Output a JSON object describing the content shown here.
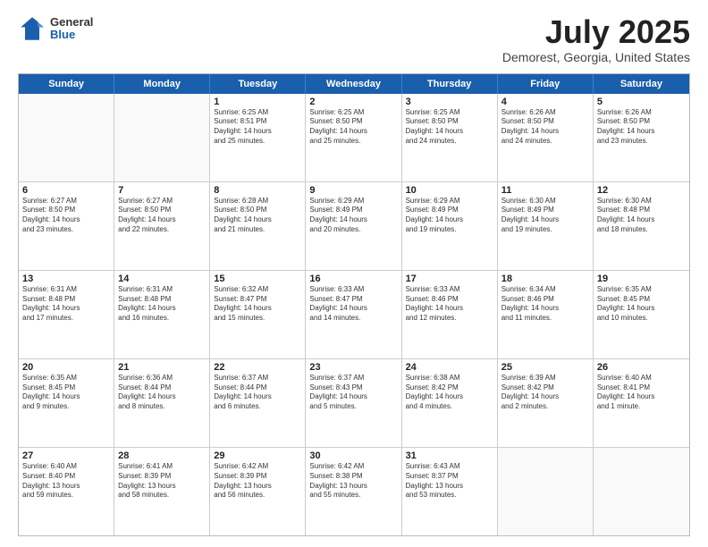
{
  "header": {
    "logo": {
      "general": "General",
      "blue": "Blue"
    },
    "title": "July 2025",
    "location": "Demorest, Georgia, United States"
  },
  "weekdays": [
    "Sunday",
    "Monday",
    "Tuesday",
    "Wednesday",
    "Thursday",
    "Friday",
    "Saturday"
  ],
  "weeks": [
    [
      {
        "day": "",
        "empty": true,
        "lines": []
      },
      {
        "day": "",
        "empty": true,
        "lines": []
      },
      {
        "day": "1",
        "empty": false,
        "lines": [
          "Sunrise: 6:25 AM",
          "Sunset: 8:51 PM",
          "Daylight: 14 hours",
          "and 25 minutes."
        ]
      },
      {
        "day": "2",
        "empty": false,
        "lines": [
          "Sunrise: 6:25 AM",
          "Sunset: 8:50 PM",
          "Daylight: 14 hours",
          "and 25 minutes."
        ]
      },
      {
        "day": "3",
        "empty": false,
        "lines": [
          "Sunrise: 6:25 AM",
          "Sunset: 8:50 PM",
          "Daylight: 14 hours",
          "and 24 minutes."
        ]
      },
      {
        "day": "4",
        "empty": false,
        "lines": [
          "Sunrise: 6:26 AM",
          "Sunset: 8:50 PM",
          "Daylight: 14 hours",
          "and 24 minutes."
        ]
      },
      {
        "day": "5",
        "empty": false,
        "lines": [
          "Sunrise: 6:26 AM",
          "Sunset: 8:50 PM",
          "Daylight: 14 hours",
          "and 23 minutes."
        ]
      }
    ],
    [
      {
        "day": "6",
        "empty": false,
        "lines": [
          "Sunrise: 6:27 AM",
          "Sunset: 8:50 PM",
          "Daylight: 14 hours",
          "and 23 minutes."
        ]
      },
      {
        "day": "7",
        "empty": false,
        "lines": [
          "Sunrise: 6:27 AM",
          "Sunset: 8:50 PM",
          "Daylight: 14 hours",
          "and 22 minutes."
        ]
      },
      {
        "day": "8",
        "empty": false,
        "lines": [
          "Sunrise: 6:28 AM",
          "Sunset: 8:50 PM",
          "Daylight: 14 hours",
          "and 21 minutes."
        ]
      },
      {
        "day": "9",
        "empty": false,
        "lines": [
          "Sunrise: 6:29 AM",
          "Sunset: 8:49 PM",
          "Daylight: 14 hours",
          "and 20 minutes."
        ]
      },
      {
        "day": "10",
        "empty": false,
        "lines": [
          "Sunrise: 6:29 AM",
          "Sunset: 8:49 PM",
          "Daylight: 14 hours",
          "and 19 minutes."
        ]
      },
      {
        "day": "11",
        "empty": false,
        "lines": [
          "Sunrise: 6:30 AM",
          "Sunset: 8:49 PM",
          "Daylight: 14 hours",
          "and 19 minutes."
        ]
      },
      {
        "day": "12",
        "empty": false,
        "lines": [
          "Sunrise: 6:30 AM",
          "Sunset: 8:48 PM",
          "Daylight: 14 hours",
          "and 18 minutes."
        ]
      }
    ],
    [
      {
        "day": "13",
        "empty": false,
        "lines": [
          "Sunrise: 6:31 AM",
          "Sunset: 8:48 PM",
          "Daylight: 14 hours",
          "and 17 minutes."
        ]
      },
      {
        "day": "14",
        "empty": false,
        "lines": [
          "Sunrise: 6:31 AM",
          "Sunset: 8:48 PM",
          "Daylight: 14 hours",
          "and 16 minutes."
        ]
      },
      {
        "day": "15",
        "empty": false,
        "lines": [
          "Sunrise: 6:32 AM",
          "Sunset: 8:47 PM",
          "Daylight: 14 hours",
          "and 15 minutes."
        ]
      },
      {
        "day": "16",
        "empty": false,
        "lines": [
          "Sunrise: 6:33 AM",
          "Sunset: 8:47 PM",
          "Daylight: 14 hours",
          "and 14 minutes."
        ]
      },
      {
        "day": "17",
        "empty": false,
        "lines": [
          "Sunrise: 6:33 AM",
          "Sunset: 8:46 PM",
          "Daylight: 14 hours",
          "and 12 minutes."
        ]
      },
      {
        "day": "18",
        "empty": false,
        "lines": [
          "Sunrise: 6:34 AM",
          "Sunset: 8:46 PM",
          "Daylight: 14 hours",
          "and 11 minutes."
        ]
      },
      {
        "day": "19",
        "empty": false,
        "lines": [
          "Sunrise: 6:35 AM",
          "Sunset: 8:45 PM",
          "Daylight: 14 hours",
          "and 10 minutes."
        ]
      }
    ],
    [
      {
        "day": "20",
        "empty": false,
        "lines": [
          "Sunrise: 6:35 AM",
          "Sunset: 8:45 PM",
          "Daylight: 14 hours",
          "and 9 minutes."
        ]
      },
      {
        "day": "21",
        "empty": false,
        "lines": [
          "Sunrise: 6:36 AM",
          "Sunset: 8:44 PM",
          "Daylight: 14 hours",
          "and 8 minutes."
        ]
      },
      {
        "day": "22",
        "empty": false,
        "lines": [
          "Sunrise: 6:37 AM",
          "Sunset: 8:44 PM",
          "Daylight: 14 hours",
          "and 6 minutes."
        ]
      },
      {
        "day": "23",
        "empty": false,
        "lines": [
          "Sunrise: 6:37 AM",
          "Sunset: 8:43 PM",
          "Daylight: 14 hours",
          "and 5 minutes."
        ]
      },
      {
        "day": "24",
        "empty": false,
        "lines": [
          "Sunrise: 6:38 AM",
          "Sunset: 8:42 PM",
          "Daylight: 14 hours",
          "and 4 minutes."
        ]
      },
      {
        "day": "25",
        "empty": false,
        "lines": [
          "Sunrise: 6:39 AM",
          "Sunset: 8:42 PM",
          "Daylight: 14 hours",
          "and 2 minutes."
        ]
      },
      {
        "day": "26",
        "empty": false,
        "lines": [
          "Sunrise: 6:40 AM",
          "Sunset: 8:41 PM",
          "Daylight: 14 hours",
          "and 1 minute."
        ]
      }
    ],
    [
      {
        "day": "27",
        "empty": false,
        "lines": [
          "Sunrise: 6:40 AM",
          "Sunset: 8:40 PM",
          "Daylight: 13 hours",
          "and 59 minutes."
        ]
      },
      {
        "day": "28",
        "empty": false,
        "lines": [
          "Sunrise: 6:41 AM",
          "Sunset: 8:39 PM",
          "Daylight: 13 hours",
          "and 58 minutes."
        ]
      },
      {
        "day": "29",
        "empty": false,
        "lines": [
          "Sunrise: 6:42 AM",
          "Sunset: 8:39 PM",
          "Daylight: 13 hours",
          "and 56 minutes."
        ]
      },
      {
        "day": "30",
        "empty": false,
        "lines": [
          "Sunrise: 6:42 AM",
          "Sunset: 8:38 PM",
          "Daylight: 13 hours",
          "and 55 minutes."
        ]
      },
      {
        "day": "31",
        "empty": false,
        "lines": [
          "Sunrise: 6:43 AM",
          "Sunset: 8:37 PM",
          "Daylight: 13 hours",
          "and 53 minutes."
        ]
      },
      {
        "day": "",
        "empty": true,
        "lines": []
      },
      {
        "day": "",
        "empty": true,
        "lines": []
      }
    ]
  ]
}
